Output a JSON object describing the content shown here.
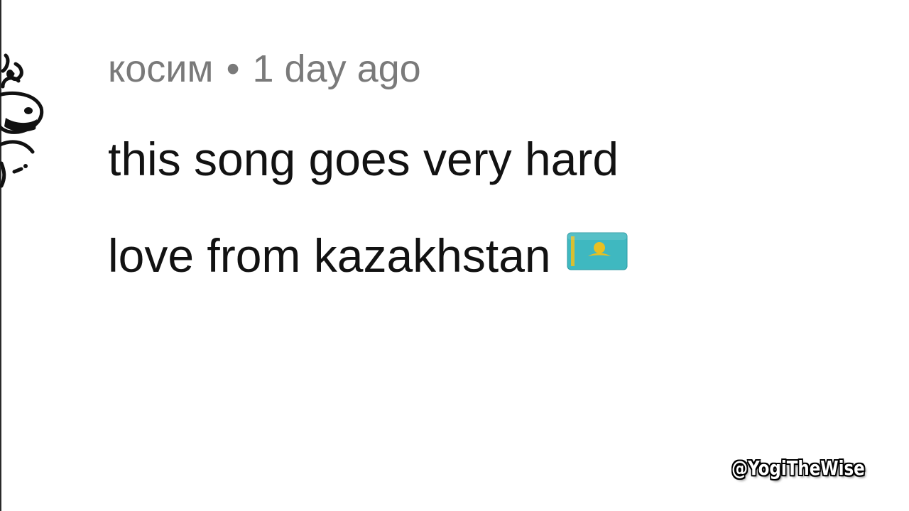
{
  "comment": {
    "author": "косим",
    "separator": "•",
    "time": "1 day ago",
    "line1": "this song goes very hard",
    "line2": "love from kazakhstan",
    "flag_icon": "kazakhstan-flag-icon",
    "flag_colors": {
      "field": "#3fb8c0",
      "emblem": "#e8c021"
    }
  },
  "avatar": {
    "icon": "avatar-drawing-icon"
  },
  "watermark": {
    "text": "@YogiTheWise"
  }
}
